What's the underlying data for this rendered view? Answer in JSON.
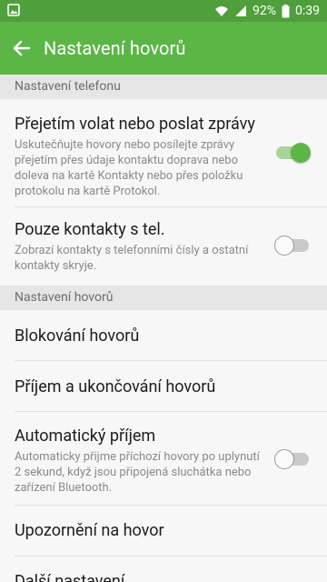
{
  "status_bar": {
    "battery_text": "92%",
    "time": "0:39",
    "icons": [
      "image-notification-icon",
      "wifi-icon",
      "signal-icon",
      "battery-icon"
    ]
  },
  "app_bar": {
    "title": "Nastavení hovorů",
    "back_icon": "arrow-left-icon"
  },
  "sections": {
    "phone_settings": "Nastavení telefonu",
    "call_settings": "Nastavení hovorů"
  },
  "items": {
    "swipe": {
      "title": "Přejetím volat nebo poslat zprávy",
      "subtitle": "Uskutečňujte hovory nebo posílejte zprávy přejetím přes údaje kontaktu doprava nebo doleva na kartě Kontakty nebo přes položku protokolu na kartě Protokol.",
      "enabled": true
    },
    "contacts_only": {
      "title": "Pouze kontakty s tel.",
      "subtitle": "Zobrazí kontakty s telefonními čísly a ostatní kontakty skryje.",
      "enabled": false
    },
    "blocking": {
      "title": "Blokování hovorů"
    },
    "answering": {
      "title": "Příjem a ukončování hovorů"
    },
    "auto_answer": {
      "title": "Automatický příjem",
      "subtitle": "Automaticky přijme příchozí hovory po uplynutí 2 sekund, když jsou připojená sluchátka nebo zařízení Bluetooth.",
      "enabled": false
    },
    "call_alerts": {
      "title": "Upozornění na hovor"
    },
    "more": {
      "title": "Další nastavení"
    }
  },
  "colors": {
    "status_bar": "#4f9f3c",
    "app_bar": "#5cb646",
    "switch_on": "#5cb646",
    "section_bg": "#e6e6e6"
  }
}
